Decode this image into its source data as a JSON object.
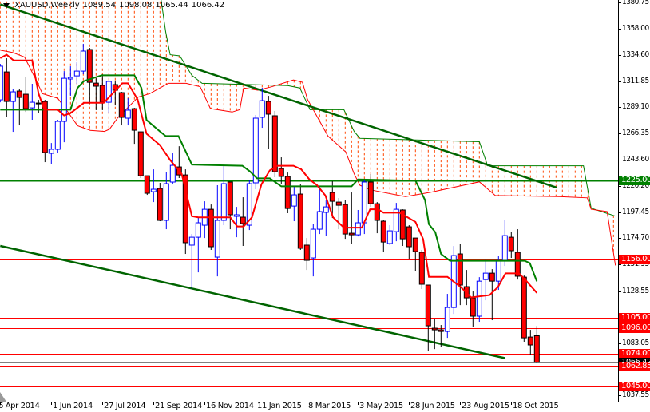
{
  "header": {
    "symbol": "XAUUSD,Weekly",
    "open": "1089.54",
    "high": "1098.08",
    "low": "1065.44",
    "close": "1066.42"
  },
  "colors": {
    "bull": "#0000ff",
    "bear": "#ff0000",
    "tenkan": "#ff0000",
    "kijun": "#008000",
    "trendline": "#006400",
    "cloud": "#ff4500",
    "support_resistance": "#ff0000",
    "bid_line": "#808080"
  },
  "price_axis": {
    "labels": [
      "1380.75",
      "1358.00",
      "1334.60",
      "1311.85",
      "1289.10",
      "1266.35",
      "1243.60",
      "1220.20",
      "1197.45",
      "1174.70",
      "1151.95",
      "1128.55",
      "1083.05",
      "1037.55"
    ]
  },
  "price_levels": [
    {
      "label": "1225.00",
      "value": 1225.0,
      "color": "#008000"
    },
    {
      "label": "1156.00",
      "value": 1156.0,
      "color": "#ff0000"
    },
    {
      "label": "1105.00",
      "value": 1105.0,
      "color": "#ff0000"
    },
    {
      "label": "1096.00",
      "value": 1096.0,
      "color": "#ff0000"
    },
    {
      "label": "1074.00",
      "value": 1074.0,
      "color": "#ff0000"
    },
    {
      "label": "1066.42",
      "value": 1066.42,
      "color": "#000000"
    },
    {
      "label": "1062.85",
      "value": 1062.85,
      "color": "#ff0000"
    },
    {
      "label": "1045.00",
      "value": 1045.0,
      "color": "#ff0000"
    }
  ],
  "time_axis": {
    "labels": [
      "6 Apr 2014",
      "1 Jun 2014",
      "27 Jul 2014",
      "21 Sep 2014",
      "16 Nov 2014",
      "11 Jan 2015",
      "8 Mar 2015",
      "3 May 2015",
      "28 Jun 2015",
      "23 Aug 2015",
      "18 Oct 2015"
    ]
  },
  "chart_data": {
    "type": "candlestick",
    "title": "XAUUSD,Weekly",
    "ylim": [
      1037.55,
      1380.75
    ],
    "ohlc": [
      [
        1295.6,
        1327.0,
        1293.5,
        1325.0
      ],
      [
        1320.0,
        1331.9,
        1280.3,
        1294.2
      ],
      [
        1294.2,
        1305.4,
        1267.7,
        1302.6
      ],
      [
        1303.3,
        1305.4,
        1273.3,
        1297.7
      ],
      [
        1300.5,
        1315.8,
        1285.1,
        1287.9
      ],
      [
        1288.6,
        1309.6,
        1278.2,
        1293.5
      ],
      [
        1292.8,
        1295.6,
        1283.8,
        1292.5
      ],
      [
        1294.2,
        1295.6,
        1241.2,
        1249.6
      ],
      [
        1248.9,
        1257.9,
        1239.8,
        1252.4
      ],
      [
        1252.4,
        1278.2,
        1249.6,
        1276.8
      ],
      [
        1276.8,
        1320.7,
        1258.6,
        1314.4
      ],
      [
        1313.8,
        1324.9,
        1299.1,
        1315.1
      ],
      [
        1316.5,
        1328.4,
        1309.6,
        1320.7
      ],
      [
        1320.7,
        1344.5,
        1317.9,
        1338.2
      ],
      [
        1339.6,
        1341.0,
        1292.1,
        1310.9
      ],
      [
        1310.2,
        1314.4,
        1286.6,
        1307.5
      ],
      [
        1308.2,
        1317.9,
        1286.6,
        1293.5
      ],
      [
        1293.5,
        1311.7,
        1283.8,
        1311.7
      ],
      [
        1308.9,
        1311.7,
        1290.7,
        1304.0
      ],
      [
        1301.9,
        1302.6,
        1273.3,
        1280.3
      ],
      [
        1279.6,
        1297.0,
        1273.3,
        1286.6
      ],
      [
        1287.9,
        1288.6,
        1257.2,
        1269.1
      ],
      [
        1267.7,
        1267.7,
        1227.3,
        1229.3
      ],
      [
        1229.3,
        1229.3,
        1212.6,
        1214.0
      ],
      [
        1215.4,
        1234.9,
        1206.3,
        1217.5
      ],
      [
        1218.2,
        1223.1,
        1189.6,
        1190.3
      ],
      [
        1190.3,
        1232.8,
        1182.6,
        1222.4
      ],
      [
        1223.8,
        1248.9,
        1222.4,
        1238.4
      ],
      [
        1237.0,
        1255.1,
        1227.3,
        1230.0
      ],
      [
        1230.0,
        1234.9,
        1161.0,
        1170.8
      ],
      [
        1168.7,
        1178.4,
        1130.3,
        1175.6
      ],
      [
        1175.6,
        1192.4,
        1144.9,
        1188.2
      ],
      [
        1186.1,
        1207.0,
        1174.9,
        1200.0
      ],
      [
        1200.0,
        1204.2,
        1164.5,
        1167.3
      ],
      [
        1158.2,
        1221.0,
        1141.4,
        1190.3
      ],
      [
        1190.3,
        1237.7,
        1186.1,
        1222.4
      ],
      [
        1223.8,
        1223.8,
        1182.6,
        1195.2
      ],
      [
        1193.8,
        1202.1,
        1175.6,
        1195.2
      ],
      [
        1193.1,
        1210.5,
        1168.0,
        1187.5
      ],
      [
        1186.1,
        1225.9,
        1181.9,
        1222.4
      ],
      [
        1223.1,
        1282.4,
        1217.5,
        1279.6
      ],
      [
        1280.3,
        1306.1,
        1271.2,
        1294.9
      ],
      [
        1294.2,
        1299.1,
        1252.4,
        1283.1
      ],
      [
        1281.7,
        1285.9,
        1228.0,
        1232.8
      ],
      [
        1235.6,
        1245.4,
        1221.7,
        1228.7
      ],
      [
        1228.7,
        1232.1,
        1196.6,
        1200.7
      ],
      [
        1202.8,
        1219.6,
        1189.6,
        1212.6
      ],
      [
        1213.3,
        1222.4,
        1164.5,
        1165.9
      ],
      [
        1168.7,
        1174.9,
        1147.0,
        1155.4
      ],
      [
        1157.5,
        1187.5,
        1141.4,
        1182.6
      ],
      [
        1182.6,
        1220.3,
        1178.4,
        1198.0
      ],
      [
        1197.3,
        1208.4,
        1177.0,
        1202.1
      ],
      [
        1214.7,
        1224.5,
        1192.4,
        1207.0
      ],
      [
        1206.3,
        1209.8,
        1182.6,
        1203.5
      ],
      [
        1204.2,
        1208.4,
        1174.2,
        1178.4
      ],
      [
        1179.1,
        1214.7,
        1169.4,
        1177.7
      ],
      [
        1177.7,
        1199.4,
        1176.3,
        1188.2
      ],
      [
        1188.2,
        1226.6,
        1178.4,
        1223.8
      ],
      [
        1223.8,
        1230.7,
        1202.1,
        1204.9
      ],
      [
        1204.9,
        1206.3,
        1179.1,
        1190.3
      ],
      [
        1189.6,
        1191.0,
        1162.4,
        1171.4
      ],
      [
        1170.1,
        1186.1,
        1168.7,
        1181.2
      ],
      [
        1180.5,
        1205.6,
        1172.1,
        1200.0
      ],
      [
        1199.4,
        1200.0,
        1168.0,
        1174.2
      ],
      [
        1184.7,
        1186.1,
        1156.8,
        1167.3
      ],
      [
        1174.9,
        1174.9,
        1146.3,
        1163.1
      ],
      [
        1162.4,
        1164.5,
        1130.3,
        1134.5
      ],
      [
        1133.8,
        1133.8,
        1075.9,
        1098.2
      ],
      [
        1096.1,
        1103.8,
        1077.9,
        1094.7
      ],
      [
        1094.7,
        1098.9,
        1080.0,
        1093.3
      ],
      [
        1093.3,
        1126.1,
        1087.7,
        1114.2
      ],
      [
        1114.2,
        1167.9,
        1108.6,
        1159.6
      ],
      [
        1161.0,
        1169.4,
        1116.3,
        1133.8
      ],
      [
        1132.4,
        1147.0,
        1116.3,
        1122.6
      ],
      [
        1122.6,
        1128.2,
        1097.5,
        1106.6
      ],
      [
        1106.6,
        1140.7,
        1101.7,
        1137.2
      ],
      [
        1138.6,
        1156.1,
        1120.5,
        1144.2
      ],
      [
        1144.2,
        1147.7,
        1103.1,
        1137.2
      ],
      [
        1137.2,
        1158.9,
        1129.6,
        1155.4
      ],
      [
        1155.4,
        1191.0,
        1150.5,
        1177.0
      ],
      [
        1175.6,
        1180.5,
        1157.5,
        1163.8
      ],
      [
        1162.4,
        1182.6,
        1138.6,
        1141.5
      ],
      [
        1140.7,
        1142.1,
        1084.3,
        1087.7
      ],
      [
        1088.4,
        1094.7,
        1073.1,
        1081.5
      ],
      [
        1089.54,
        1098.08,
        1065.44,
        1066.42
      ]
    ],
    "tenkan": [
      [
        0,
        1332
      ],
      [
        1,
        1335
      ],
      [
        2.1,
        1330
      ],
      [
        5,
        1330
      ],
      [
        6,
        1301
      ],
      [
        6.9,
        1287
      ],
      [
        9,
        1287
      ],
      [
        10,
        1282
      ],
      [
        11,
        1284
      ],
      [
        13.1,
        1293
      ],
      [
        16.2,
        1293
      ],
      [
        19.1,
        1310
      ],
      [
        20,
        1310
      ],
      [
        21.5,
        1296
      ],
      [
        22.9,
        1266
      ],
      [
        25,
        1256
      ],
      [
        26.6,
        1243
      ],
      [
        28.4,
        1231
      ],
      [
        30,
        1194
      ],
      [
        31,
        1193
      ],
      [
        36,
        1193
      ],
      [
        37.1,
        1185
      ],
      [
        38.1,
        1185
      ],
      [
        39.4,
        1193
      ],
      [
        40.9,
        1222
      ],
      [
        42.2,
        1234
      ],
      [
        43.4,
        1238
      ],
      [
        45.9,
        1238
      ],
      [
        47.1,
        1235
      ],
      [
        48.4,
        1226
      ],
      [
        49.6,
        1221
      ],
      [
        50.9,
        1212
      ],
      [
        52.1,
        1193
      ],
      [
        53.8,
        1184
      ],
      [
        56.6,
        1184
      ],
      [
        57.9,
        1200
      ],
      [
        59.1,
        1200
      ],
      [
        60,
        1197
      ],
      [
        62.5,
        1197
      ],
      [
        65,
        1189
      ],
      [
        66.2,
        1174
      ],
      [
        67.1,
        1141
      ],
      [
        70,
        1141
      ],
      [
        72.1,
        1132
      ],
      [
        73.7,
        1123
      ],
      [
        76.6,
        1125
      ],
      [
        77.9,
        1132
      ],
      [
        79.1,
        1144
      ],
      [
        81.2,
        1144
      ],
      [
        82.1,
        1139
      ],
      [
        84,
        1127
      ]
    ],
    "kijun": [
      [
        0,
        1287
      ],
      [
        11,
        1287
      ],
      [
        12.1,
        1306
      ],
      [
        13.1,
        1312
      ],
      [
        15.9,
        1317
      ],
      [
        21,
        1317
      ],
      [
        22.1,
        1306
      ],
      [
        22.9,
        1278
      ],
      [
        25,
        1268
      ],
      [
        25.9,
        1264
      ],
      [
        27.9,
        1264
      ],
      [
        30,
        1239
      ],
      [
        37.9,
        1238
      ],
      [
        39.1,
        1233
      ],
      [
        40.2,
        1227
      ],
      [
        42.2,
        1227
      ],
      [
        44,
        1220
      ],
      [
        55,
        1220
      ],
      [
        56,
        1226
      ],
      [
        65,
        1225
      ],
      [
        66.5,
        1208
      ],
      [
        67.1,
        1187
      ],
      [
        68.1,
        1180
      ],
      [
        69,
        1161
      ],
      [
        70.4,
        1155
      ],
      [
        82.1,
        1155
      ],
      [
        82.9,
        1153
      ],
      [
        84,
        1137
      ]
    ],
    "cloud_upper": [
      [
        0,
        1390
      ],
      [
        25,
        1390
      ],
      [
        25.9,
        1355
      ],
      [
        26.6,
        1335
      ],
      [
        28.1,
        1334
      ],
      [
        30,
        1317
      ],
      [
        31.6,
        1310
      ],
      [
        45,
        1308
      ],
      [
        46.9,
        1306
      ],
      [
        48.5,
        1287
      ],
      [
        53.8,
        1287
      ],
      [
        55.4,
        1268
      ],
      [
        56.3,
        1262
      ],
      [
        75,
        1259
      ],
      [
        76.3,
        1238
      ],
      [
        91.3,
        1238
      ],
      [
        92.5,
        1201
      ],
      [
        96.3,
        1194
      ]
    ],
    "cloud_lower": [
      [
        0,
        1339
      ],
      [
        1.9,
        1337
      ],
      [
        3.8,
        1333
      ],
      [
        5.6,
        1313
      ],
      [
        6.6,
        1301
      ],
      [
        9,
        1297
      ],
      [
        10.6,
        1285
      ],
      [
        12.1,
        1273
      ],
      [
        14.1,
        1269
      ],
      [
        16.3,
        1268
      ],
      [
        17.1,
        1270
      ],
      [
        18.4,
        1280
      ],
      [
        21.6,
        1298
      ],
      [
        23.4,
        1301
      ],
      [
        26.3,
        1310
      ],
      [
        29.1,
        1310
      ],
      [
        31.3,
        1307
      ],
      [
        32.9,
        1288
      ],
      [
        36.3,
        1285
      ],
      [
        37.5,
        1287
      ],
      [
        38.1,
        1306
      ],
      [
        40.3,
        1304
      ],
      [
        42.5,
        1307
      ],
      [
        45.9,
        1313
      ],
      [
        47.3,
        1311
      ],
      [
        48.1,
        1296
      ],
      [
        49,
        1287
      ],
      [
        51.3,
        1264
      ],
      [
        54.1,
        1250
      ],
      [
        55.4,
        1231
      ],
      [
        56.3,
        1221
      ],
      [
        57.9,
        1217
      ],
      [
        63.4,
        1211
      ],
      [
        67.5,
        1215
      ],
      [
        75,
        1224
      ],
      [
        77.5,
        1212
      ],
      [
        87.5,
        1211
      ],
      [
        91.9,
        1210
      ],
      [
        92.5,
        1200
      ],
      [
        95,
        1198
      ],
      [
        96.3,
        1151
      ]
    ],
    "trendlines": [
      {
        "name": "upper-trendline",
        "from": [
          0,
          1379
        ],
        "to": [
          87.1,
          1219
        ]
      },
      {
        "name": "lower-trendline",
        "from": [
          0,
          1168
        ],
        "to": [
          79,
          1070
        ]
      }
    ]
  }
}
